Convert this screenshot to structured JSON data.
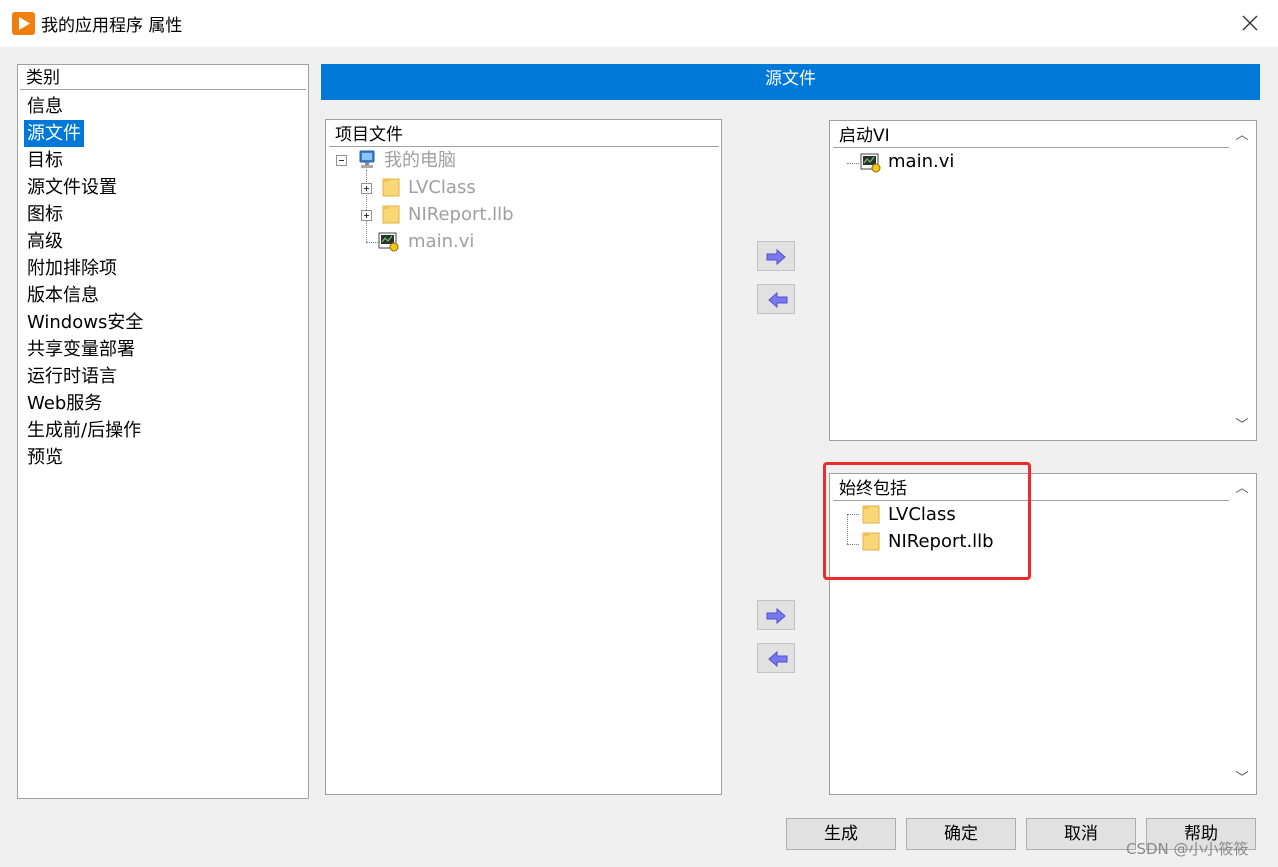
{
  "window": {
    "title": "我的应用程序 属性",
    "icon": "play-logo-icon",
    "close_icon": "close-icon"
  },
  "categories": {
    "header": "类别",
    "items": [
      "信息",
      "源文件",
      "目标",
      "源文件设置",
      "图标",
      "高级",
      "附加排除项",
      "版本信息",
      "Windows安全",
      "共享变量部署",
      "运行时语言",
      "Web服务",
      "生成前/后操作",
      "预览"
    ],
    "selected": "源文件"
  },
  "section_title": "源文件",
  "project_files": {
    "header": "项目文件",
    "root": "我的电脑",
    "children": [
      "LVClass",
      "NIReport.llb",
      "main.vi"
    ]
  },
  "startup_vis": {
    "header": "启动VI",
    "items": [
      "main.vi"
    ]
  },
  "always_include": {
    "header": "始终包括",
    "items": [
      "LVClass",
      "NIReport.llb"
    ]
  },
  "arrow_buttons": {
    "add": "arrow-right-icon",
    "remove": "arrow-left-icon"
  },
  "buttons": {
    "build": "生成",
    "ok": "确定",
    "cancel": "取消",
    "help": "帮助"
  },
  "watermark": "CSDN @小小筱筱",
  "colors": {
    "accent": "#0078d7",
    "highlight": "#ee2b2b",
    "app_icon": "#f07f0e",
    "arrow": "#6c6cf0"
  }
}
